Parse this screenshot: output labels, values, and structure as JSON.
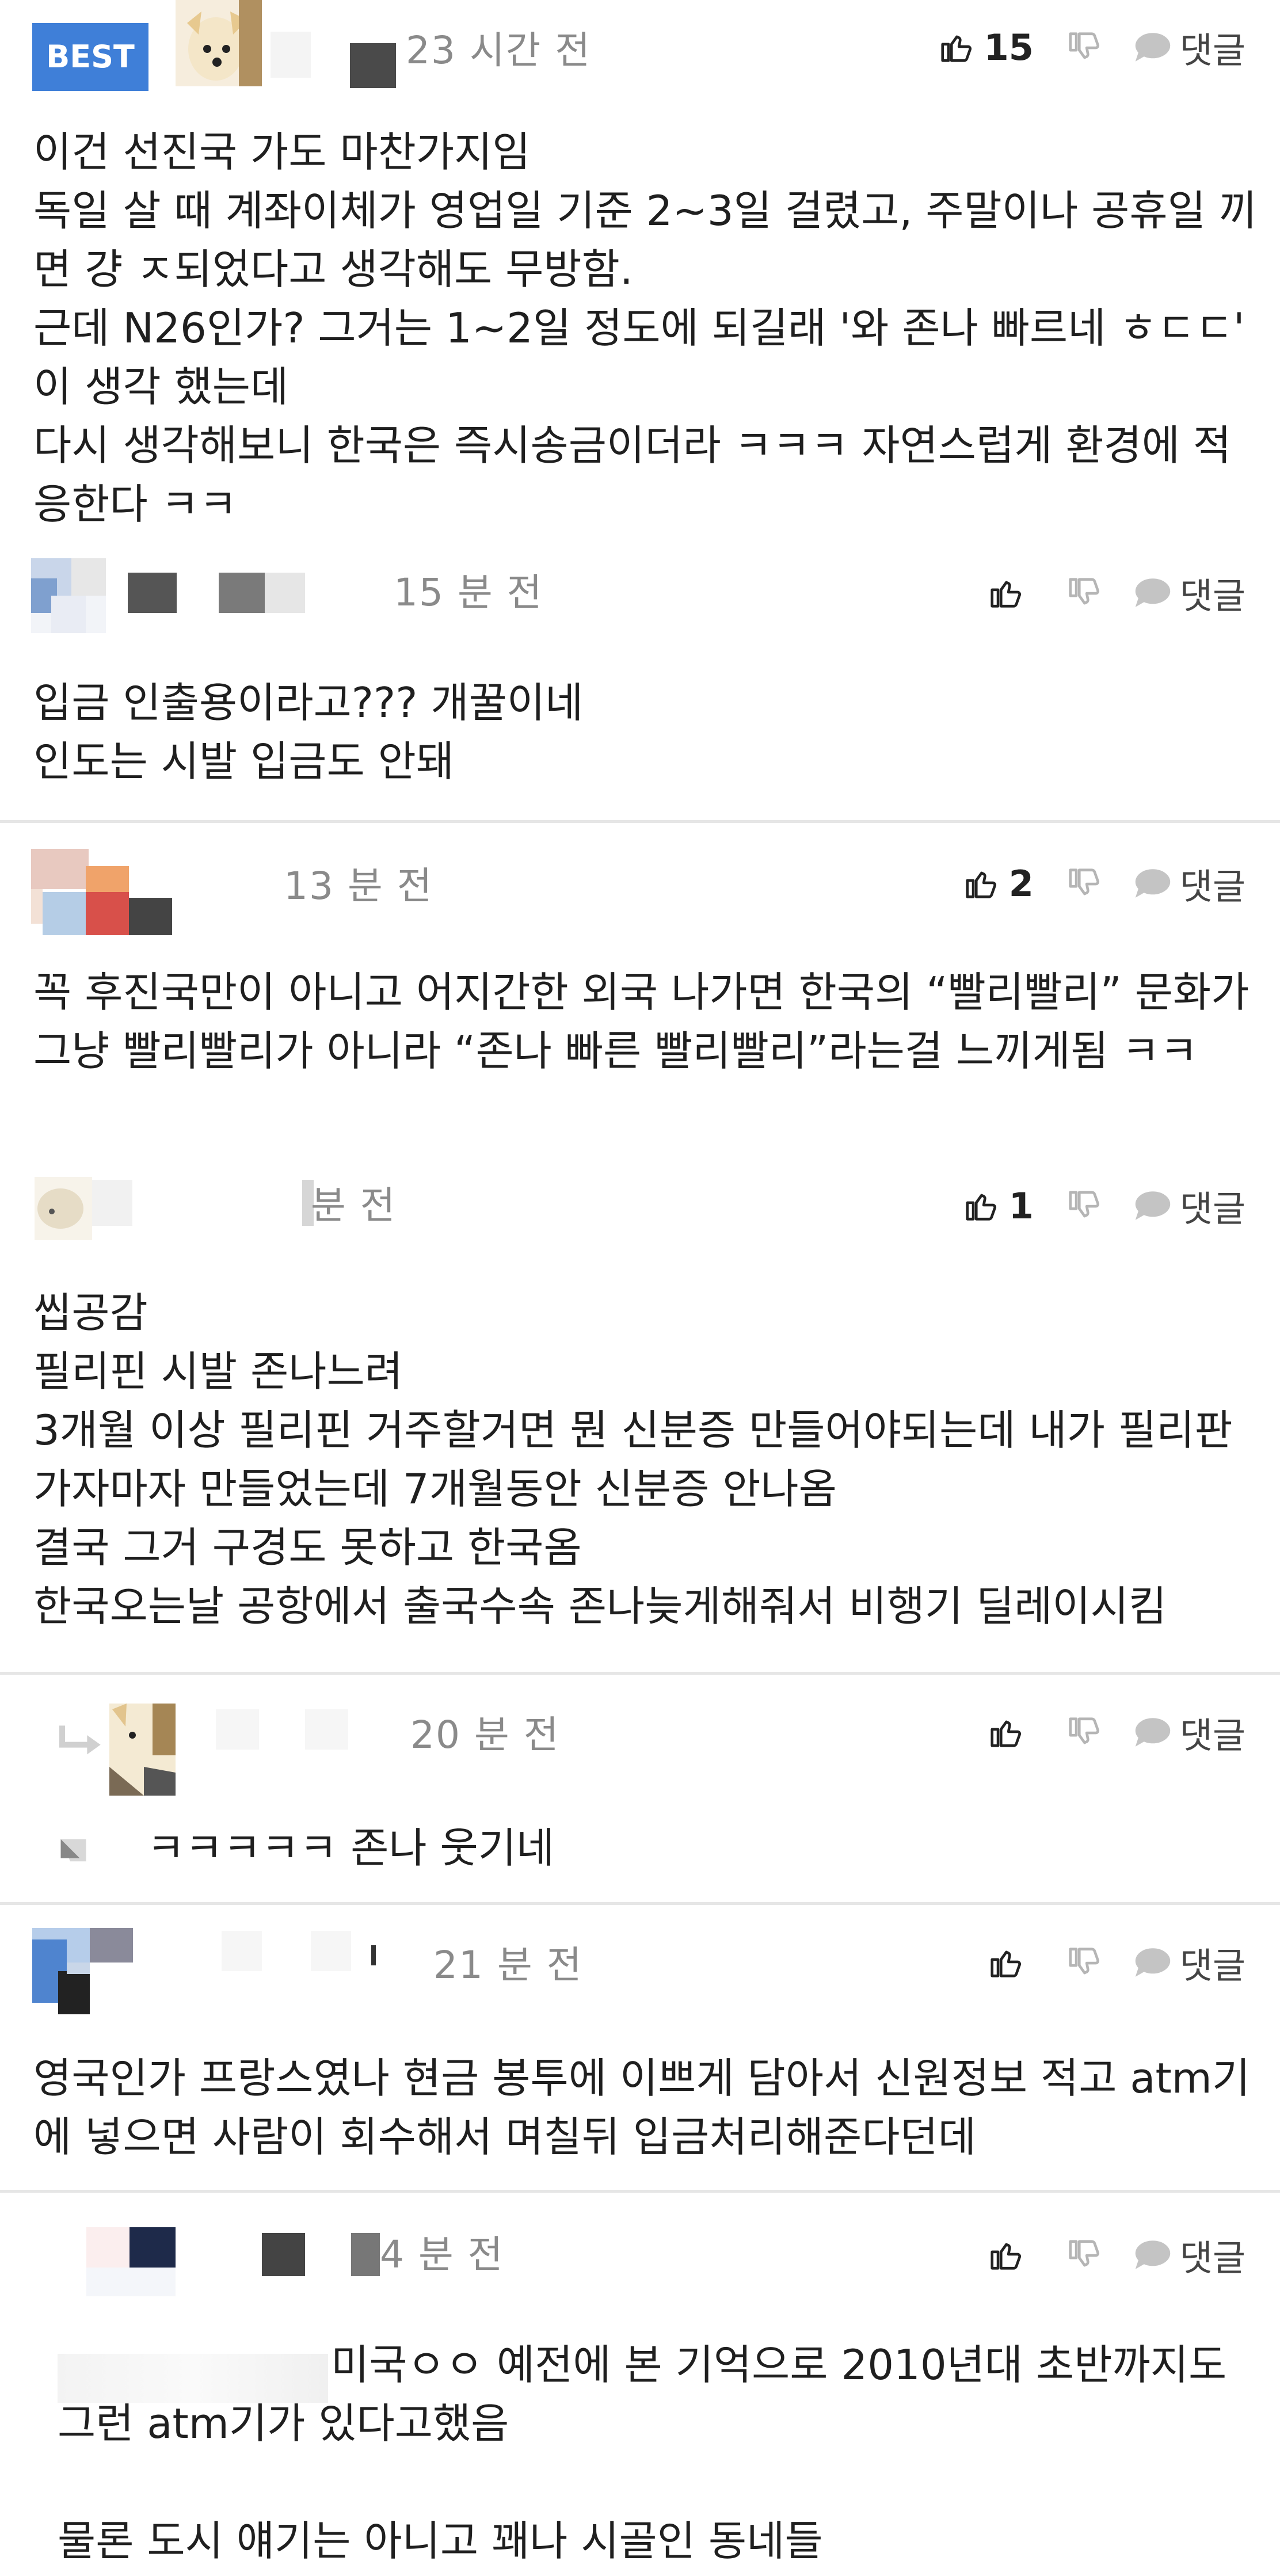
{
  "colors": {
    "best_badge": "#3f7fd8",
    "meta_text": "#8a8a8a",
    "divider": "#e6e6e6"
  },
  "comments": [
    {
      "badge": "BEST",
      "time": "23 시간 전",
      "likes": "15",
      "reply_label": "댓글",
      "text": "이건 선진국 가도 마찬가지임\n독일 살 때 계좌이체가 영업일 기준 2~3일 걸렸고, 주말이나 공휴일 끼면 걍 ㅈ되었다고 생각해도 무방함.\n근데 N26인가? 그거는 1~2일 정도에 되길래 '와 존나 빠르네 ㅎㄷㄷ' 이 생각 했는데\n다시 생각해보니 한국은 즉시송금이더라 ㅋㅋㅋ 자연스럽게 환경에 적응한다 ㅋㅋ"
    },
    {
      "time": "15 분 전",
      "likes": "",
      "reply_label": "댓글",
      "text": "입금 인출용이라고??? 개꿀이네\n인도는 시발 입금도 안돼"
    },
    {
      "time": "13 분 전",
      "likes": "2",
      "reply_label": "댓글",
      "text": "꼭 후진국만이 아니고 어지간한 외국 나가면 한국의 “빨리빨리” 문화가 그냥 빨리빨리가 아니라 “존나 빠른 빨리빨리”라는걸 느끼게됨 ㅋㅋ"
    },
    {
      "time": "분 전",
      "likes": "1",
      "reply_label": "댓글",
      "text": "씹공감\n필리핀 시발 존나느려\n3개월 이상 필리핀 거주할거면 뭔 신분증 만들어야되는데 내가 필리판 가자마자 만들었는데 7개월동안 신분증 안나옴\n결국 그거 구경도 못하고 한국옴\n한국오는날 공항에서 출국수속 존나늦게해줘서 비행기 딜레이시킴"
    },
    {
      "time": "20 분 전",
      "likes": "",
      "reply_label": "댓글",
      "text": "ㅋㅋㅋㅋㅋ 존나 웃기네",
      "is_reply": true
    },
    {
      "time": "21 분 전",
      "likes": "",
      "reply_label": "댓글",
      "text": "영국인가 프랑스였나 현금 봉투에 이쁘게 담아서 신원정보 적고 atm기에 넣으면 사람이 회수해서 며칠뒤 입금처리해준다던데"
    },
    {
      "time": "4 분 전",
      "likes": "",
      "reply_label": "댓글",
      "text": "미국ㅇㅇ 예전에 본 기억으로 2010년대 초반까지도 그런 atm기가 있다고했음\n\n물론 도시 얘기는 아니고 꽤나 시골인 동네들"
    }
  ]
}
